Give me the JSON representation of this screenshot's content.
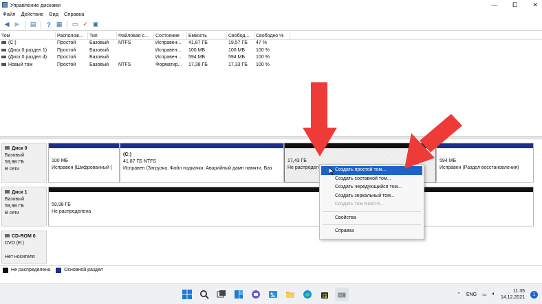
{
  "window": {
    "title": "Управление дисками",
    "controls": {
      "minimize": "—",
      "maximize": "⧠",
      "close": "✕"
    }
  },
  "menu": [
    "Файл",
    "Действие",
    "Вид",
    "Справка"
  ],
  "toolbar": {
    "icons": [
      "back-icon",
      "forward-icon",
      "volume-list-icon",
      "help-icon",
      "properties-icon",
      "refresh-icon",
      "checklist-icon",
      "disk-view-icon"
    ]
  },
  "volumes": {
    "headers": [
      "Том",
      "Располож...",
      "Тип",
      "Файловая с...",
      "Состояние",
      "Емкость",
      "Свобод...",
      "Свободно %"
    ],
    "rows": [
      [
        "(C:)",
        "Простой",
        "Базовый",
        "NTFS",
        "Исправен...",
        "41,87 ГБ",
        "19,57 ГБ",
        "47 %"
      ],
      [
        "(Диск 0 раздел 1)",
        "Простой",
        "Базовый",
        "",
        "Исправен...",
        "100 МБ",
        "100 МБ",
        "100 %"
      ],
      [
        "(Диск 0 раздел 4)",
        "Простой",
        "Базовый",
        "",
        "Исправен...",
        "594 МБ",
        "594 МБ",
        "100 %"
      ],
      [
        "Новый том",
        "Простой",
        "Базовый",
        "NTFS",
        "Форматир...",
        "17,38 ГБ",
        "17,33 ГБ",
        "100 %"
      ]
    ]
  },
  "disks": {
    "disk0": {
      "name": "Диск 0",
      "type": "Базовый",
      "size": "59,98 ГБ",
      "status": "В сети",
      "p1": {
        "line1": "100 МБ",
        "line2": "Исправен (Шифрованный ("
      },
      "p2": {
        "title": "(C:)",
        "line1": "41,87 ГБ NTFS",
        "line2": "Исправен (Загрузка, Файл подкачки, Аварийный дамп памяти, Баз"
      },
      "p3": {
        "line1": "17,43 ГБ",
        "line2": "Не распредел"
      },
      "p4": {
        "line1": "594 МБ",
        "line2": "Исправен (Раздел восстановления)"
      }
    },
    "disk1": {
      "name": "Диск 1",
      "type": "Базовый",
      "size": "59,98 ГБ",
      "status": "В сети",
      "p1": {
        "line1": "59,98 ГБ",
        "line2": "Не распределена"
      }
    },
    "cdrom": {
      "name": "CD-ROM 0",
      "type": "DVD (E:)",
      "status": "Нет носителя"
    }
  },
  "legend": {
    "unallocated": "Не распределена",
    "primary": "Основной раздел",
    "unallocated_color": "#111111",
    "primary_color": "#1b2e8f"
  },
  "context_menu": {
    "items": [
      {
        "label": "Создать простой том...",
        "state": "highlighted"
      },
      {
        "label": "Создать составной том...",
        "state": "normal"
      },
      {
        "label": "Создать чередующийся том...",
        "state": "normal"
      },
      {
        "label": "Создать зеркальный том...",
        "state": "normal"
      },
      {
        "label": "Создать том RAID-5...",
        "state": "disabled"
      }
    ],
    "properties": "Свойства",
    "help": "Справка"
  },
  "taskbar": {
    "icons": [
      "windows-start-icon",
      "search-icon",
      "task-view-icon",
      "widgets-icon",
      "teams-chat-icon",
      "photos-icon",
      "file-explorer-icon",
      "edge-icon",
      "store-icon",
      "disk-management-icon"
    ],
    "lang": "ENG",
    "time": "11:35",
    "date": "14.12.2021",
    "notifications": "1"
  },
  "colors": {
    "accent": "#1e64c8",
    "arrow": "#ee3b37",
    "primary_partition": "#1b2e8f"
  }
}
